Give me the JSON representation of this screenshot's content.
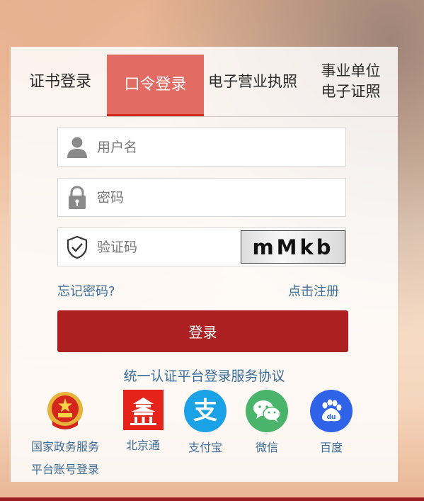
{
  "tabs": [
    {
      "label": "证书登录",
      "active": false
    },
    {
      "label": "口令登录",
      "active": true
    },
    {
      "label": "电子营业执照",
      "active": false
    },
    {
      "label_line1": "事业单位",
      "label_line2": "电子证照",
      "active": false
    }
  ],
  "form": {
    "username_placeholder": "用户名",
    "password_placeholder": "密码",
    "captcha_placeholder": "验证码",
    "captcha_text": "mMkb",
    "forgot_label": "忘记密码?",
    "register_label": "点击注册",
    "login_label": "登录"
  },
  "agreement_label": "统一认证平台登录服务协议",
  "third_party": {
    "gov_line1": "国家政务服务",
    "gov_line2": "平台账号登录",
    "beijingtong": "北京通",
    "alipay": "支付宝",
    "wechat": "微信",
    "baidu": "百度"
  },
  "colors": {
    "accent_red": "#ac2021",
    "active_tab": "#e26b63",
    "link_blue": "#3c6d99",
    "alipay_blue": "#1aa1e6",
    "wechat_green": "#4ab46a",
    "baidu_blue": "#2e63e8"
  },
  "icons": [
    "user-icon",
    "lock-icon",
    "shield-check-icon",
    "national-emblem-icon",
    "beijingtong-icon",
    "alipay-icon",
    "wechat-icon",
    "baidu-icon"
  ]
}
